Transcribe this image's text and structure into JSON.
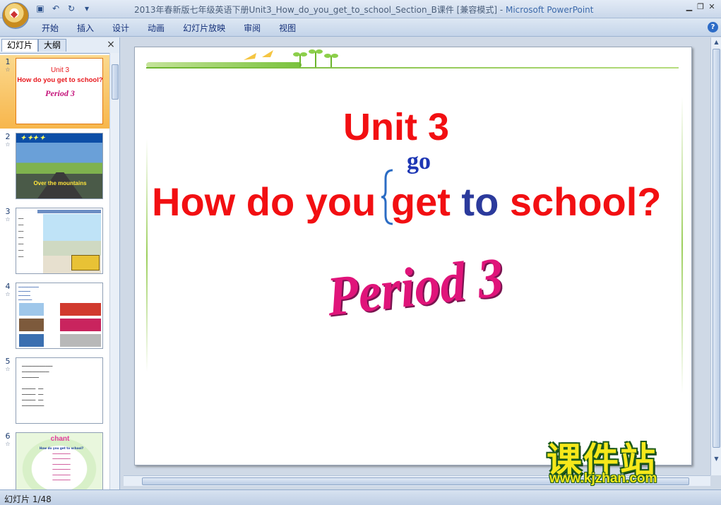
{
  "window": {
    "title": "2013年春新版七年级英语下册Unit3_How_do_you_get_to_school_Section_B课件 [兼容模式]",
    "separator": " - ",
    "app_name": "Microsoft PowerPoint"
  },
  "ribbon": {
    "tabs": [
      "开始",
      "插入",
      "设计",
      "动画",
      "幻灯片放映",
      "审阅",
      "视图"
    ]
  },
  "panel": {
    "tab_slides": "幻灯片",
    "tab_outline": "大纲",
    "close": "×"
  },
  "thumbnails": [
    {
      "number": "1",
      "unit": "Unit 3",
      "question_a": "How do you",
      "question_b": "get to school?",
      "period": "Period 3"
    },
    {
      "number": "2",
      "caption": "Over the mountains"
    },
    {
      "number": "3"
    },
    {
      "number": "4"
    },
    {
      "number": "5"
    },
    {
      "number": "6",
      "title": "chant",
      "subtitle": "How do you get to school?"
    }
  ],
  "slide": {
    "unit": "Unit 3",
    "question_pre": "How do you ",
    "question_get": "get",
    "question_to": "to",
    "question_post": " school?",
    "alt_word": "go",
    "period": "Period 3"
  },
  "watermark": {
    "chinese": "课件站",
    "url": "www.kjzhan.com"
  },
  "status": {
    "slide_indicator": "幻灯片 1/48"
  },
  "colors": {
    "title_red": "#f20f12",
    "to_blue": "#2b3a9c",
    "go_blue": "#1d36b4",
    "period_pink": "#e0147a",
    "selected_thumb": "#f7b64c"
  }
}
